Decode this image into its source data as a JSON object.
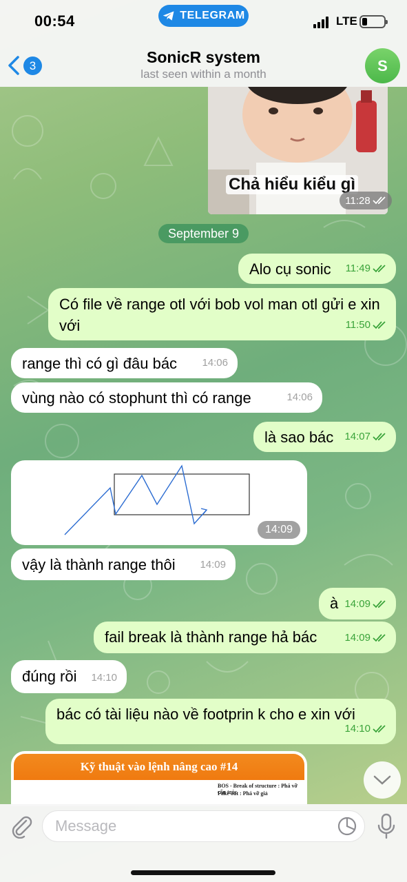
{
  "status_bar": {
    "time": "00:54",
    "app_pill": "TELEGRAM",
    "network": "LTE"
  },
  "header": {
    "back_count": "3",
    "title": "SonicR system",
    "subtitle": "last seen within a month",
    "avatar_letter": "S"
  },
  "sticker": {
    "caption": "Chả hiểu kiểu gì",
    "time": "11:28"
  },
  "date_separator": "September 9",
  "messages": [
    {
      "dir": "out",
      "text": "Alo cụ sonic",
      "time": "11:49"
    },
    {
      "dir": "out",
      "text": "Có file về range otl với bob vol man otl gửi e xin với",
      "time": "11:50"
    },
    {
      "dir": "in",
      "text": "range thì có gì đâu bác",
      "time": "14:06"
    },
    {
      "dir": "in",
      "text": "vùng nào có stophunt thì có range",
      "time": "14:06"
    },
    {
      "dir": "out",
      "text": "là sao bác",
      "time": "14:07"
    },
    {
      "dir": "in",
      "text": "vậy là thành range thôi",
      "time": "14:09"
    },
    {
      "dir": "out",
      "text": "à",
      "time": "14:09"
    },
    {
      "dir": "out",
      "text": "fail break là thành range hả bác",
      "time": "14:09"
    },
    {
      "dir": "in",
      "text": "đúng rồi",
      "time": "14:10"
    },
    {
      "dir": "out",
      "text": "bác có tài liệu nào về footprin k cho e xin với",
      "time": "14:10"
    }
  ],
  "image_message": {
    "time": "14:09"
  },
  "document_preview": {
    "banner": "Kỹ thuật vào lệnh nâng cao #14",
    "line1": "BOS - Break of structure : Phá vỡ cấu trúc",
    "line2": "Fake out : Phá vỡ giả"
  },
  "composer": {
    "placeholder": "Message"
  },
  "colors": {
    "accent": "#1e88e5",
    "outgoing_bubble": "#e2fec8",
    "incoming_bubble": "#ffffff",
    "date_pill": "#4a9a62"
  }
}
